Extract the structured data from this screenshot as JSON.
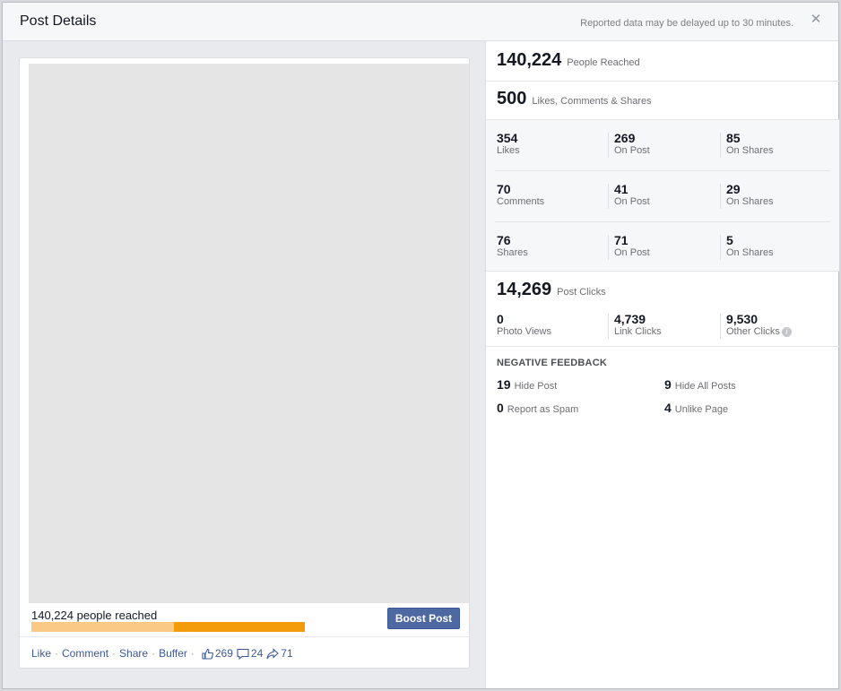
{
  "dialog": {
    "title": "Post Details",
    "note": "Reported data may be delayed up to 30 minutes.",
    "close_icon": "close-icon"
  },
  "post": {
    "reach_label": "140,224 people reached",
    "reach_organic_fraction": 0.48,
    "reach_colors": {
      "paid": "#fbc986",
      "organic": "#f49b0b"
    },
    "boost_label": "Boost Post",
    "actions": [
      "Like",
      "Comment",
      "Share",
      "Buffer"
    ],
    "likes_count": "269",
    "comments_count": "24",
    "shares_count": "71"
  },
  "stats": {
    "reached": {
      "value": "140,224",
      "label": "People Reached"
    },
    "engagement": {
      "value": "500",
      "label": "Likes, Comments & Shares"
    },
    "rows": [
      {
        "total": {
          "value": "354",
          "label": "Likes"
        },
        "on_post": {
          "value": "269",
          "label": "On Post"
        },
        "on_shares": {
          "value": "85",
          "label": "On Shares"
        }
      },
      {
        "total": {
          "value": "70",
          "label": "Comments"
        },
        "on_post": {
          "value": "41",
          "label": "On Post"
        },
        "on_shares": {
          "value": "29",
          "label": "On Shares"
        }
      },
      {
        "total": {
          "value": "76",
          "label": "Shares"
        },
        "on_post": {
          "value": "71",
          "label": "On Post"
        },
        "on_shares": {
          "value": "5",
          "label": "On Shares"
        }
      }
    ],
    "clicks": {
      "value": "14,269",
      "label": "Post Clicks"
    },
    "click_breakdown": [
      {
        "value": "0",
        "label": "Photo Views"
      },
      {
        "value": "4,739",
        "label": "Link Clicks"
      },
      {
        "value": "9,530",
        "label": "Other Clicks"
      }
    ],
    "negative": {
      "title": "NEGATIVE FEEDBACK",
      "items": [
        {
          "value": "19",
          "label": "Hide Post"
        },
        {
          "value": "9",
          "label": "Hide All Posts"
        },
        {
          "value": "0",
          "label": "Report as Spam"
        },
        {
          "value": "4",
          "label": "Unlike Page"
        }
      ]
    }
  }
}
